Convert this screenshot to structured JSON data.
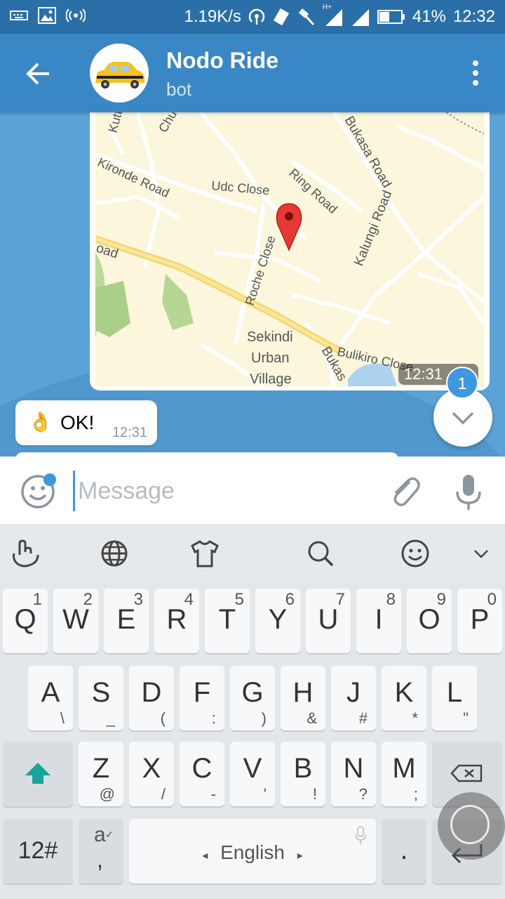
{
  "status_bar": {
    "net_speed": "1.19K/s",
    "network": "H+",
    "battery": "41%",
    "time": "12:32"
  },
  "header": {
    "title": "Nodo Ride",
    "subtitle": "bot"
  },
  "map": {
    "labels": [
      "Kutt",
      "Chur",
      "Bukasa Road",
      "Kironde Road",
      "Udc Close",
      "Ring Road",
      "Kalungi Road",
      "oad",
      "Roche Close",
      "Sekindi",
      "Urban",
      "Village",
      "Bukas",
      "Bulikiro Close"
    ],
    "time": "12:31"
  },
  "messages": [
    {
      "emoji": "👌",
      "text": "OK!",
      "time": "12:31"
    }
  ],
  "unread_count": "1",
  "input": {
    "placeholder": "Message"
  },
  "keyboard": {
    "row1": [
      {
        "k": "Q",
        "s": "1"
      },
      {
        "k": "W",
        "s": "2"
      },
      {
        "k": "E",
        "s": "3"
      },
      {
        "k": "R",
        "s": "4"
      },
      {
        "k": "T",
        "s": "5"
      },
      {
        "k": "Y",
        "s": "6"
      },
      {
        "k": "U",
        "s": "7"
      },
      {
        "k": "I",
        "s": "8"
      },
      {
        "k": "O",
        "s": "9"
      },
      {
        "k": "P",
        "s": "0"
      }
    ],
    "row2": [
      {
        "k": "A",
        "s": "\\"
      },
      {
        "k": "S",
        "s": "_"
      },
      {
        "k": "D",
        "s": "("
      },
      {
        "k": "F",
        "s": ":"
      },
      {
        "k": "G",
        "s": ")"
      },
      {
        "k": "H",
        "s": "&"
      },
      {
        "k": "J",
        "s": "#"
      },
      {
        "k": "K",
        "s": "*"
      },
      {
        "k": "L",
        "s": "\""
      }
    ],
    "row3": [
      {
        "k": "Z",
        "s": "@"
      },
      {
        "k": "X",
        "s": "/"
      },
      {
        "k": "C",
        "s": "-"
      },
      {
        "k": "V",
        "s": "'"
      },
      {
        "k": "B",
        "s": "!"
      },
      {
        "k": "N",
        "s": "?"
      },
      {
        "k": "M",
        "s": ";"
      }
    ],
    "num_key": "12#",
    "lang_key_top": "a",
    "lang_key_bottom": ",",
    "space_label": "English",
    "period_key": "."
  }
}
